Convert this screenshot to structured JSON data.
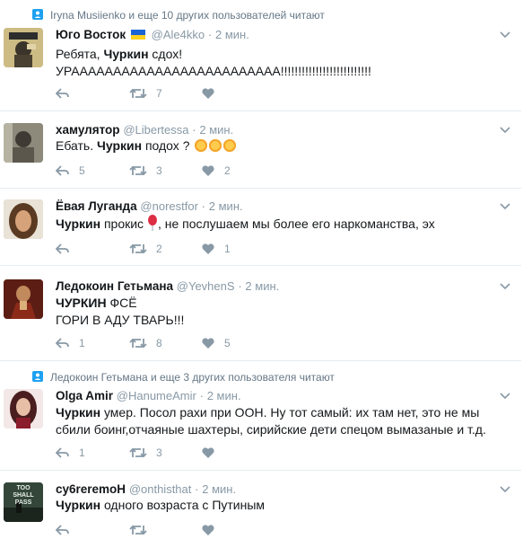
{
  "tweets": [
    {
      "context": "Iryna Musiienko и еще 10 других пользователей читают",
      "name": "Юго Восток",
      "handle": "@Ale4kko",
      "time": "2 мин.",
      "text_pre": "Ребята, ",
      "text_bold": "Чуркин",
      "text_post": " сдох!",
      "text_line2": "УРААААААААААААААААААААААААА!!!!!!!!!!!!!!!!!!!!!!!!!!",
      "replies": "",
      "retweets": "7",
      "likes": ""
    },
    {
      "name": "хамулятор",
      "handle": "@Libertessa",
      "time": "2 мин.",
      "text_pre": "Ебать. ",
      "text_bold": "Чуркин",
      "text_post": " подох ?",
      "replies": "5",
      "retweets": "3",
      "likes": "2"
    },
    {
      "name": "Ёвая Луганда",
      "handle": "@norestfor",
      "time": "2 мин.",
      "text_bold": "Чуркин",
      "text_post": " прокис",
      "text_after_emoji": ", не послушаем мы более его наркоманства, эх",
      "replies": "",
      "retweets": "2",
      "likes": "1"
    },
    {
      "name": "Ледокоин Гетьмана",
      "handle": "@YevhenS",
      "time": "2 мин.",
      "text_bold": "ЧУРКИН",
      "text_post": " ФСЁ",
      "text_line2": "ГОРИ В АДУ ТВАРЬ!!!",
      "replies": "1",
      "retweets": "8",
      "likes": "5"
    },
    {
      "context": "Ледокоин Гетьмана и еще 3 других пользователя читают",
      "name": "Olga Amir",
      "handle": "@HanumeAmir",
      "time": "2 мин.",
      "text_bold": "Чуркин",
      "text_post": " умер. Посол рахи при ООН. Ну тот самый: их там нет, это не мы",
      "text_line2": "сбили боинг,отчаяные шахтеры, сирийские дети спецом вымазаные и т.д.",
      "replies": "1",
      "retweets": "3",
      "likes": ""
    },
    {
      "name": "су6reremoH",
      "handle": "@onthisthat",
      "time": "2 мин.",
      "text_bold": "Чуркин",
      "text_post": " одного возраста с Путиным",
      "avatar_text": "TOO SHALL PASS",
      "replies": "",
      "retweets": "",
      "likes": ""
    }
  ],
  "colors": {
    "text": "#14171a",
    "muted": "#8899a6",
    "divider": "#e6ecf0",
    "context_icon": "#1da1f2"
  }
}
